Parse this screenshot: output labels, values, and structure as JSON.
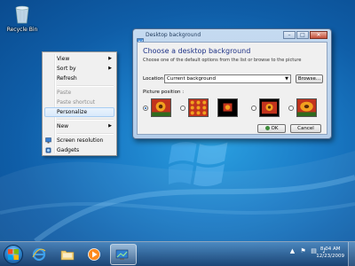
{
  "desktop": {
    "icons": [
      {
        "label": "Recycle Bin",
        "icon": "recycle-bin-icon"
      }
    ]
  },
  "context_menu": {
    "items": [
      {
        "label": "View",
        "submenu": true,
        "enabled": true
      },
      {
        "label": "Sort by",
        "submenu": true,
        "enabled": true
      },
      {
        "label": "Refresh",
        "enabled": true
      },
      {
        "label": "Paste",
        "enabled": false
      },
      {
        "label": "Paste shortcut",
        "enabled": false
      },
      {
        "label": "Personalize",
        "enabled": true,
        "highlighted": true
      },
      {
        "label": "New",
        "submenu": true,
        "enabled": true
      },
      {
        "label": "Screen resolution",
        "enabled": true,
        "icon": "display-icon"
      },
      {
        "label": "Gadgets",
        "enabled": true,
        "icon": "gadgets-icon"
      }
    ]
  },
  "dialog": {
    "title": "Desktop background",
    "heading": "Choose a desktop background",
    "description": "Choose one of the default options from the list or browse to the picture",
    "location_label": "Location",
    "location_value": "Current background",
    "browse_label": "Browse...",
    "position_label": "Picture position :",
    "positions": [
      {
        "name": "fill",
        "selected": true
      },
      {
        "name": "tile",
        "selected": false
      },
      {
        "name": "center",
        "selected": false
      },
      {
        "name": "fit",
        "selected": false
      },
      {
        "name": "stretch",
        "selected": false
      }
    ],
    "ok_label": "OK",
    "cancel_label": "Cancel"
  },
  "taskbar": {
    "pinned": [
      "internet-explorer-icon",
      "folder-icon",
      "media-player-icon",
      "personalize-app-icon"
    ],
    "active_index": 3,
    "clock_time": "8:04 AM",
    "clock_date": "12/23/2009"
  },
  "colors": {
    "heading": "#1e3287",
    "wallpaper": "#1a7bc6",
    "selection": "#d8e9fb"
  }
}
